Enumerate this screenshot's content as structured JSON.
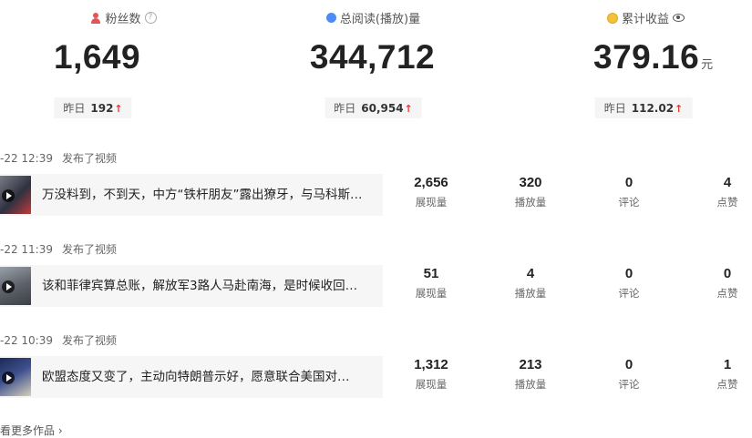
{
  "stats": [
    {
      "label": "粉丝数",
      "value": "1,649",
      "unit": "",
      "yesterday_label": "昨日",
      "yesterday_value": "192",
      "icon": "user-icon",
      "extra_icon": "help-icon"
    },
    {
      "label": "总阅读(播放)量",
      "value": "344,712",
      "unit": "",
      "yesterday_label": "昨日",
      "yesterday_value": "60,954",
      "icon": "drop-icon",
      "extra_icon": ""
    },
    {
      "label": "累计收益",
      "value": "379.16",
      "unit": "元",
      "yesterday_label": "昨日",
      "yesterday_value": "112.02",
      "icon": "coin-icon",
      "extra_icon": "eye-icon"
    }
  ],
  "up_arrow": "↑",
  "posts": [
    {
      "time": "-22 12:39",
      "action": "发布了视频",
      "title": "万没料到，不到天，中方“铁杆朋友”露出獠牙，与马科斯…",
      "metrics": [
        {
          "value": "2,656",
          "label": "展现量"
        },
        {
          "value": "320",
          "label": "播放量"
        },
        {
          "value": "0",
          "label": "评论"
        },
        {
          "value": "4",
          "label": "点赞"
        }
      ]
    },
    {
      "time": "-22 11:39",
      "action": "发布了视频",
      "title": "该和菲律宾算总账，解放军3路人马赴南海，是时候收回…",
      "metrics": [
        {
          "value": "51",
          "label": "展现量"
        },
        {
          "value": "4",
          "label": "播放量"
        },
        {
          "value": "0",
          "label": "评论"
        },
        {
          "value": "0",
          "label": "点赞"
        }
      ]
    },
    {
      "time": "-22 10:39",
      "action": "发布了视频",
      "title": "欧盟态度又变了，主动向特朗普示好，愿意联合美国对…",
      "metrics": [
        {
          "value": "1,312",
          "label": "展现量"
        },
        {
          "value": "213",
          "label": "播放量"
        },
        {
          "value": "0",
          "label": "评论"
        },
        {
          "value": "1",
          "label": "点赞"
        }
      ]
    }
  ],
  "more_link": "看更多作品",
  "more_chevron": "›"
}
